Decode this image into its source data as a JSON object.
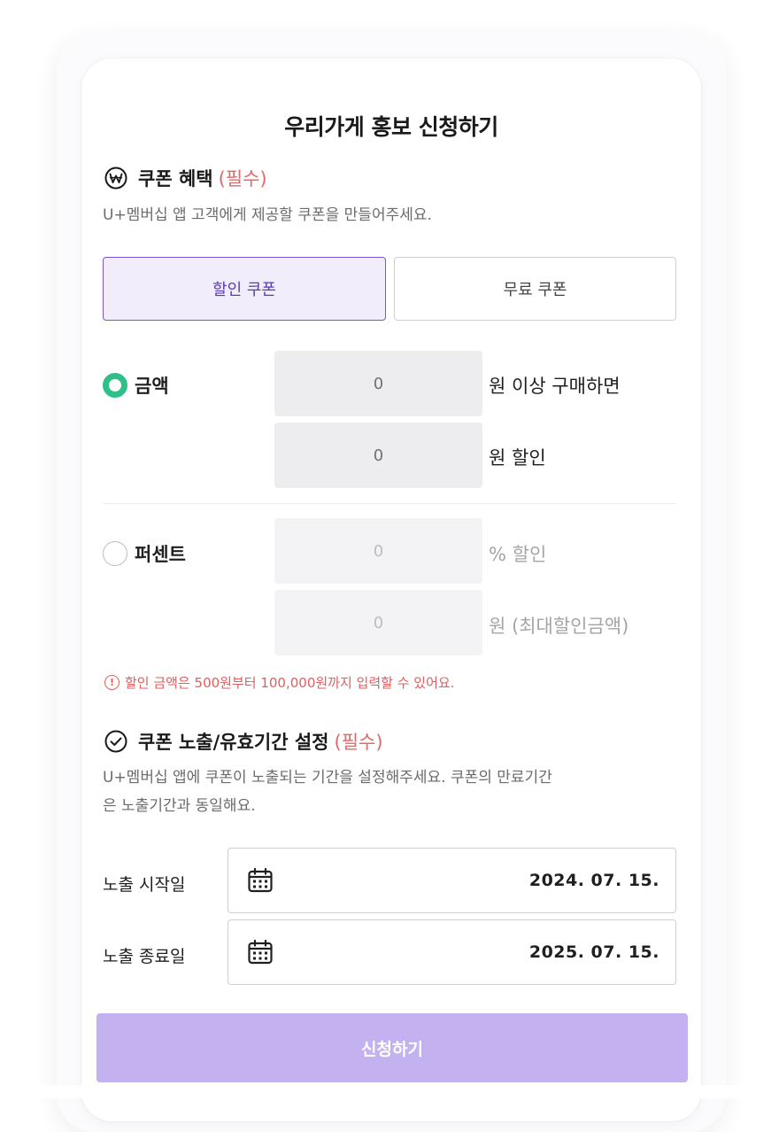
{
  "title": "우리가게 홍보 신청하기",
  "coupon_section": {
    "heading": "쿠폰 혜택",
    "required": "(필수)",
    "description": "U+멤버십 앱 고객에게 제공할 쿠폰을 만들어주세요.",
    "tabs": [
      {
        "label": "할인 쿠폰",
        "active": true
      },
      {
        "label": "무료 쿠폰",
        "active": false
      }
    ],
    "amount_option": {
      "label": "금액",
      "selected": true,
      "min_purchase_value": "0",
      "min_purchase_suffix": "원 이상 구매하면",
      "discount_value": "0",
      "discount_suffix": "원 할인"
    },
    "percent_option": {
      "label": "퍼센트",
      "selected": false,
      "percent_value": "0",
      "percent_suffix": "% 할인",
      "max_value": "0",
      "max_suffix": "원 (최대할인금액)"
    },
    "warning": "할인 금액은 500원부터 100,000원까지 입력할 수 있어요.",
    "warning_icon": "!"
  },
  "period_section": {
    "heading": "쿠폰 노출/유효기간 설정",
    "required": "(필수)",
    "description_line1": "U+멤버십 앱에 쿠폰이 노출되는 기간을 설정해주세요. 쿠폰의 만료기간",
    "description_line2": "은 노출기간과 동일해요.",
    "start": {
      "label": "노출 시작일",
      "value": "2024. 07. 15."
    },
    "end": {
      "label": "노출 종료일",
      "value": "2025. 07. 15."
    }
  },
  "submit_label": "신청하기",
  "colors": {
    "accent_purple": "#7a55d6",
    "tab_active_bg": "#f1edfb",
    "radio_green": "#2fc08a",
    "required_red": "#e06a6a",
    "submit_disabled": "#c4b1f0"
  },
  "icons": {
    "coupon_section": "won-circle-icon",
    "period_section": "check-circle-icon",
    "date_field": "calendar-icon",
    "warning": "alert-circle-icon"
  }
}
